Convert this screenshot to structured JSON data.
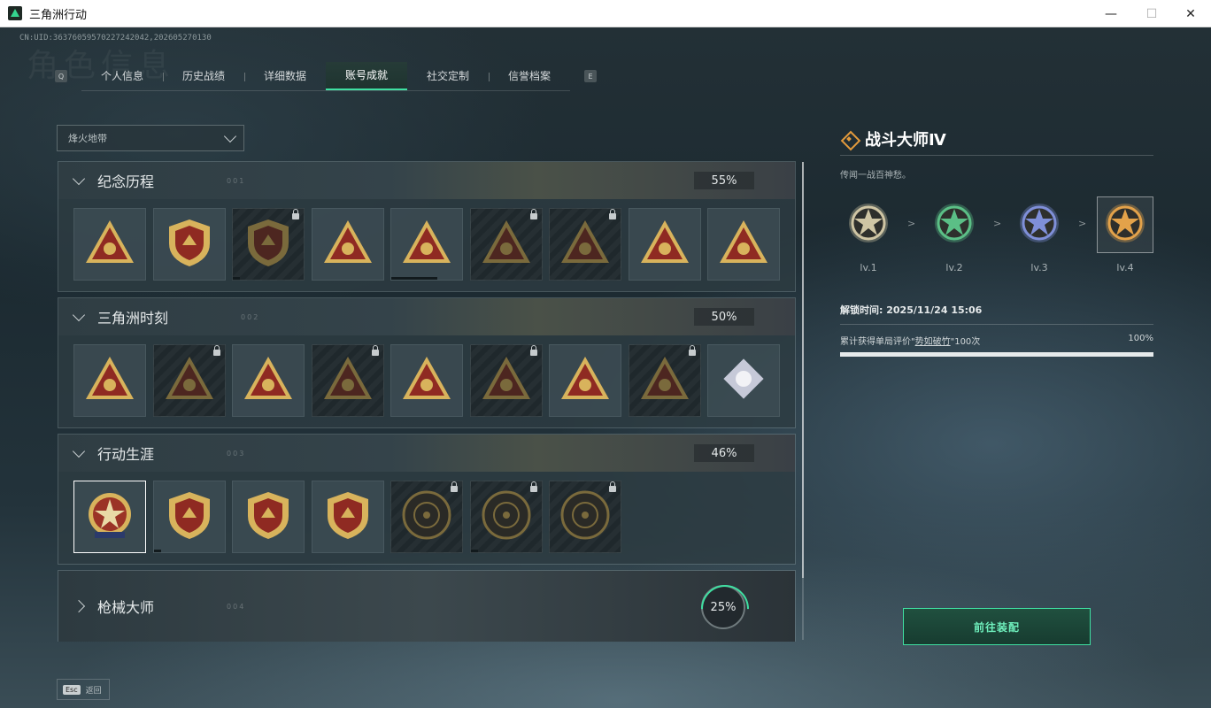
{
  "window": {
    "title": "三角洲行动",
    "minimize": "—",
    "maximize": "☐",
    "close": "✕"
  },
  "uid_text": "CN:UID:3637605957022724204​2,202605270130",
  "watermark": "角色信息",
  "tabs": {
    "left_key": "Q",
    "right_key": "E",
    "items": [
      {
        "label": "个人信息",
        "active": false
      },
      {
        "label": "历史战绩",
        "active": false
      },
      {
        "label": "详细数据",
        "active": false
      },
      {
        "label": "账号成就",
        "active": true
      },
      {
        "label": "社交定制",
        "active": false
      },
      {
        "label": "信誉档案",
        "active": false
      }
    ]
  },
  "mode_select": {
    "value": "烽火地带"
  },
  "sections": [
    {
      "title": "纪念历程",
      "code": "001",
      "percent": "55%",
      "badges": [
        {
          "icon": "triangle-emblem-icon",
          "locked": false,
          "progress": 0
        },
        {
          "icon": "helicopter-shield-icon",
          "locked": false,
          "progress": 0
        },
        {
          "icon": "dark-shield-icon",
          "locked": true,
          "progress": 0.1
        },
        {
          "icon": "number-58-triangle-icon",
          "locked": false,
          "progress": 0
        },
        {
          "icon": "vehicle-triangle-icon",
          "locked": false,
          "progress": 0.65
        },
        {
          "icon": "red-warrior-triangle-icon",
          "locked": true,
          "progress": 0
        },
        {
          "icon": "soldier-triangle-icon",
          "locked": true,
          "progress": 0
        },
        {
          "icon": "hand-triangle-icon",
          "locked": false,
          "progress": 0
        },
        {
          "icon": "number-one-triangle-icon",
          "locked": false,
          "progress": 0
        }
      ]
    },
    {
      "title": "三角洲时刻",
      "code": "002",
      "percent": "50%",
      "badges": [
        {
          "icon": "tower-triangle-icon",
          "locked": false,
          "progress": 0
        },
        {
          "icon": "bust-triangle-icon",
          "locked": true,
          "progress": 0
        },
        {
          "icon": "fighter-triangle-icon",
          "locked": false,
          "progress": 0
        },
        {
          "icon": "skull-triangle-icon",
          "locked": true,
          "progress": 0
        },
        {
          "icon": "squad-triangle-icon",
          "locked": false,
          "progress": 0
        },
        {
          "icon": "crowd-triangle-icon",
          "locked": true,
          "progress": 0
        },
        {
          "icon": "rocket-triangle-icon",
          "locked": false,
          "progress": 0
        },
        {
          "icon": "beast-triangle-icon",
          "locked": true,
          "progress": 0
        },
        {
          "icon": "flower-diamond-icon",
          "locked": false,
          "progress": 0
        }
      ]
    },
    {
      "title": "行动生涯",
      "code": "003",
      "percent": "46%",
      "badges": [
        {
          "icon": "star-medal-icon",
          "locked": false,
          "selected": true,
          "progress": 0
        },
        {
          "icon": "chevron-shield-icon",
          "locked": false,
          "progress": 0.1
        },
        {
          "icon": "fist-shield-icon",
          "locked": false,
          "progress": 0
        },
        {
          "icon": "diamond-shield-icon",
          "locked": false,
          "progress": 0
        },
        {
          "icon": "round-seal-icon",
          "locked": true,
          "progress": 0
        },
        {
          "icon": "crosshair-skull-seal-icon",
          "locked": true,
          "progress": 0.1
        },
        {
          "icon": "eye-seal-icon",
          "locked": true,
          "progress": 0
        }
      ]
    }
  ],
  "collapsed_section": {
    "title": "枪械大师",
    "code": "004",
    "percent": "25%",
    "progress": 0.25
  },
  "detail": {
    "title": "战斗大师Ⅳ",
    "description": "传闻一战百神愁。",
    "levels": [
      {
        "label": "lv.1",
        "color": "#cfc5a4"
      },
      {
        "label": "lv.2",
        "color": "#5bbf86"
      },
      {
        "label": "lv.3",
        "color": "#7f8fd8"
      },
      {
        "label": "lv.4",
        "color": "#e3a24a"
      }
    ],
    "arrow": ">",
    "unlock_time": "解锁时间: 2025/11/24 15:06",
    "condition_prefix": "累计获得单局评价\"",
    "condition_highlight": "势如破竹",
    "condition_suffix": "\"100次",
    "condition_percent": "100%",
    "condition_progress": 1.0
  },
  "equip_button": "前往装配",
  "esc": {
    "key": "Esc",
    "label": "返回"
  }
}
